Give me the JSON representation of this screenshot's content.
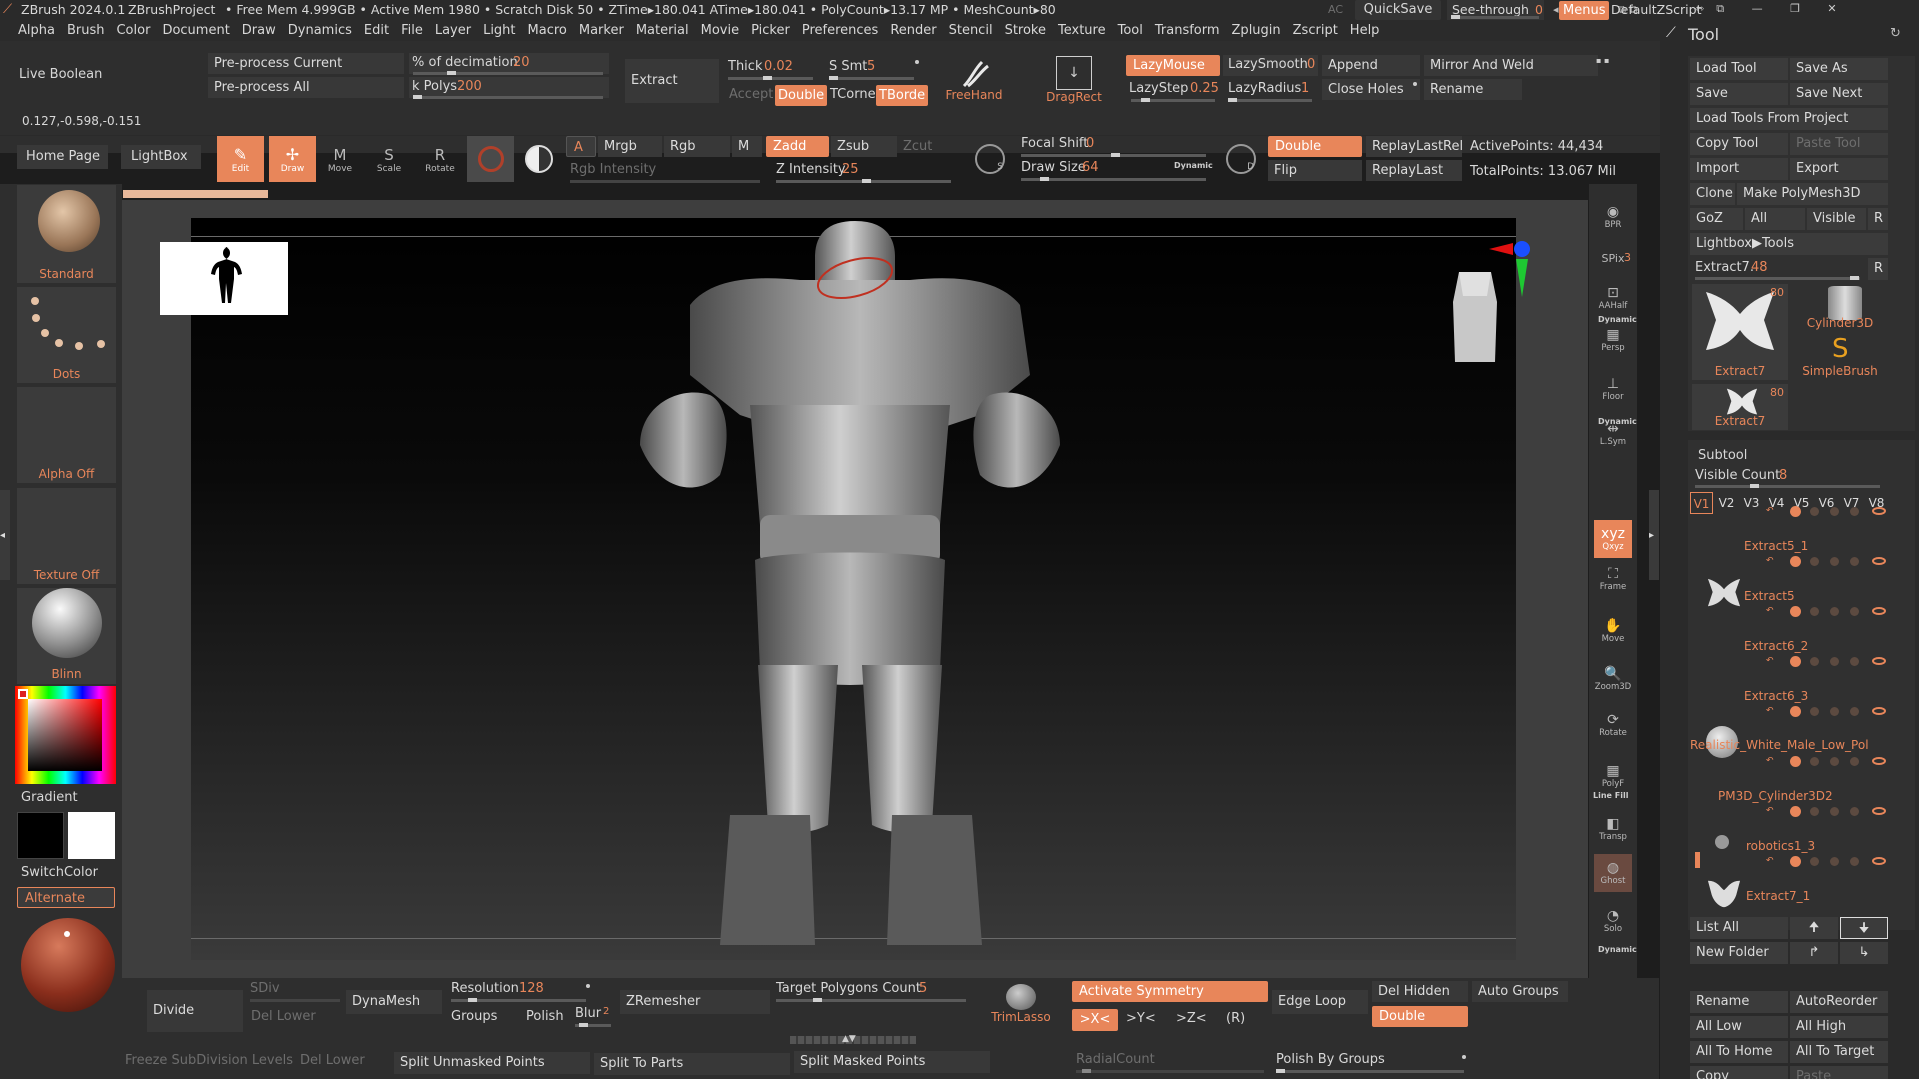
{
  "title_bar": {
    "app": "ZBrush 2024.0.1",
    "project": "ZBrushProject",
    "stats": "• Free Mem 4.999GB • Active Mem 1980 • Scratch Disk 50 • ZTime▸180.041 ATime▸180.041 • PolyCount▸13.17 MP • MeshCount▸80",
    "ac": "AC",
    "quicksave": "QuickSave",
    "seethrough": "See-through",
    "seethrough_val": "0",
    "menus": "Menus",
    "script": "DefaultZScript"
  },
  "menu": [
    "Alpha",
    "Brush",
    "Color",
    "Document",
    "Draw",
    "Dynamics",
    "Edit",
    "File",
    "Layer",
    "Light",
    "Macro",
    "Marker",
    "Material",
    "Movie",
    "Picker",
    "Preferences",
    "Render",
    "Stencil",
    "Stroke",
    "Texture",
    "Tool",
    "Transform",
    "Zplugin",
    "Zscript",
    "Help"
  ],
  "shelf": {
    "live_boolean": "Live Boolean",
    "preprocess_current": "Pre-process Current",
    "preprocess_all": "Pre-process All",
    "decimation_label": "% of decimation",
    "decimation_val": "20",
    "kpolys_label": "k Polys",
    "kpolys_val": "200",
    "extract": "Extract",
    "thick_label": "Thick",
    "thick_val": "0.02",
    "ssmt_label": "S Smt",
    "ssmt_val": "5",
    "accept": "Accept",
    "double": "Double",
    "tcorne": "TCorne",
    "tborde": "TBorde",
    "freehand": "FreeHand",
    "dragrect": "DragRect",
    "lazymouse": "LazyMouse",
    "lazysmooth_label": "LazySmooth",
    "lazysmooth_val": "0",
    "lazystep_label": "LazyStep",
    "lazystep_val": "0.25",
    "lazyradius_label": "LazyRadius",
    "lazyradius_val": "1",
    "append": "Append",
    "close_holes": "Close Holes",
    "mirror_weld": "Mirror And Weld",
    "rename": "Rename",
    "coords": "0.127,-0.598,-0.151",
    "home_page": "Home Page",
    "lightbox": "LightBox",
    "edit": "Edit",
    "draw": "Draw",
    "move": "Move",
    "scale": "Scale",
    "rotate": "Rotate",
    "a": "A",
    "mrgb": "Mrgb",
    "rgb": "Rgb",
    "m": "M",
    "zadd": "Zadd",
    "zsub": "Zsub",
    "zcut": "Zcut",
    "rgb_intensity": "Rgb Intensity",
    "z_intensity_label": "Z Intensity",
    "z_intensity_val": "25",
    "focal_shift_label": "Focal Shift",
    "focal_shift_val": "0",
    "draw_size_label": "Draw Size",
    "draw_size_val": "64",
    "dynamic": "Dynamic",
    "double2": "Double",
    "flip": "Flip",
    "replay_last_rel": "ReplayLastRel",
    "replay_last": "ReplayLast",
    "active_points": "ActivePoints: 44,434",
    "total_points": "TotalPoints: 13.067 Mil"
  },
  "left": {
    "standard": "Standard",
    "dots": "Dots",
    "alpha_off": "Alpha Off",
    "texture_off": "Texture Off",
    "blinn": "Blinn",
    "gradient": "Gradient",
    "switchcolor": "SwitchColor",
    "alternate": "Alternate"
  },
  "right_shelf": [
    "BPR",
    "SPix",
    "AAHalf",
    "Persp",
    "Floor",
    "L.Sym",
    "Qxyz",
    "Frame",
    "Move",
    "Zoom3D",
    "Rotate",
    "PolyF",
    "Transp",
    "Ghost",
    "Solo"
  ],
  "right_shelf_extra": {
    "spix_val": "3",
    "dynamic": "Dynamic",
    "linefill": "Line Fill"
  },
  "bottom": {
    "divide": "Divide",
    "sdiv": "SDiv",
    "del_lower": "Del Lower",
    "dynamesh": "DynaMesh",
    "resolution_label": "Resolution",
    "resolution_val": "128",
    "groups": "Groups",
    "polish": "Polish",
    "blur_label": "Blur",
    "blur_val": "2",
    "zremesher": "ZRemesher",
    "target_label": "Target Polygons Count",
    "target_val": "5",
    "trimlasso": "TrimLasso",
    "activate_symmetry": "Activate Symmetry",
    "x": ">X<",
    "y": ">Y<",
    "z": ">Z<",
    "r": "(R)",
    "edge_loop": "Edge Loop",
    "del_hidden": "Del Hidden",
    "auto_groups": "Auto Groups",
    "double": "Double",
    "freeze": "Freeze SubDivision Levels",
    "del_lower2": "Del Lower",
    "split_unmasked": "Split Unmasked Points",
    "split_parts": "Split To Parts",
    "split_masked": "Split Masked Points",
    "radial_count": "RadialCount",
    "polish_groups": "Polish By Groups"
  },
  "tool": {
    "title": "Tool",
    "load_tool": "Load Tool",
    "save_as": "Save As",
    "save": "Save",
    "save_next": "Save Next",
    "load_from_project": "Load Tools From Project",
    "copy_tool": "Copy Tool",
    "paste_tool": "Paste Tool",
    "import": "Import",
    "export": "Export",
    "clone": "Clone",
    "make_polymesh": "Make PolyMesh3D",
    "goz": "GoZ",
    "all": "All",
    "visible": "Visible",
    "r": "R",
    "lightbox_tools": "Lightbox▶Tools",
    "extract_label": "Extract7.",
    "extract_val": "48",
    "thumbs": [
      "Extract7",
      "Cylinder3D",
      "SimpleBrush",
      "Extract7"
    ],
    "thumb_count": "80",
    "subtool": "Subtool",
    "visible_count_label": "Visible Count",
    "visible_count_val": "8",
    "versions": [
      "V1",
      "V2",
      "V3",
      "V4",
      "V5",
      "V6",
      "V7",
      "V8"
    ],
    "subtools": [
      "Extract5_1",
      "Extract5",
      "Extract6_2",
      "Extract6_3",
      "Realistic_White_Male_Low_Pol",
      "PM3D_Cylinder3D2",
      "robotics1_3",
      "Extract7_1"
    ],
    "list_all": "List All",
    "new_folder": "New Folder",
    "rename": "Rename",
    "autoreorder": "AutoReorder",
    "all_low": "All Low",
    "all_high": "All High",
    "all_to_home": "All To Home",
    "all_to_target": "All To Target",
    "copy": "Copy",
    "paste": "Paste"
  }
}
